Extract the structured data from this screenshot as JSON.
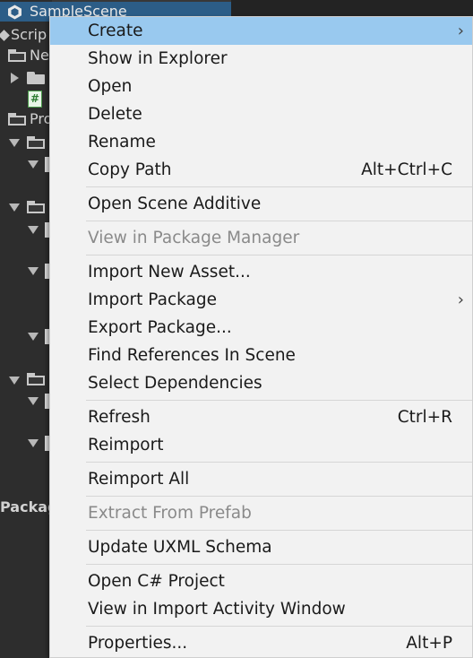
{
  "hierarchy": {
    "scene_name": "SampleScene",
    "fragments": {
      "scripts": "Scrip",
      "ne": "Ne",
      "pro": "Pro",
      "packages": "Packag"
    }
  },
  "context_menu": {
    "create": "Create",
    "show_in_explorer": "Show in Explorer",
    "open": "Open",
    "delete": "Delete",
    "rename": "Rename",
    "copy_path": "Copy Path",
    "copy_path_shortcut": "Alt+Ctrl+C",
    "open_scene_additive": "Open Scene Additive",
    "view_in_package_manager": "View in Package Manager",
    "import_new_asset": "Import New Asset...",
    "import_package": "Import Package",
    "export_package": "Export Package...",
    "find_references": "Find References In Scene",
    "select_dependencies": "Select Dependencies",
    "refresh": "Refresh",
    "refresh_shortcut": "Ctrl+R",
    "reimport": "Reimport",
    "reimport_all": "Reimport All",
    "extract_from_prefab": "Extract From Prefab",
    "update_uxml": "Update UXML Schema",
    "open_csharp_project": "Open C# Project",
    "view_import_activity": "View in Import Activity Window",
    "properties": "Properties...",
    "properties_shortcut": "Alt+P",
    "submenu_arrow": "›"
  },
  "colors": {
    "highlight": "#99c9ef",
    "menu_bg": "#f2f2f2",
    "disabled_text": "#8a8a8a",
    "selection": "#2c5d87"
  }
}
